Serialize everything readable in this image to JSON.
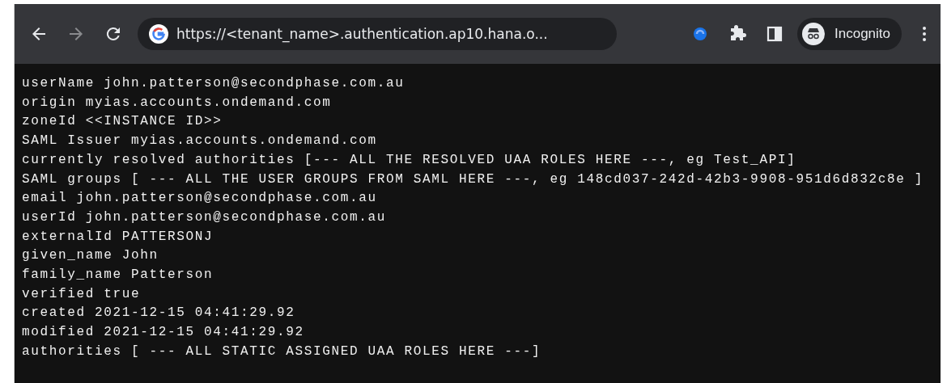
{
  "toolbar": {
    "url": "https://<tenant_name>.authentication.ap10.hana.o...",
    "profile_label": "Incognito"
  },
  "lines": [
    "userName john.patterson@secondphase.com.au",
    "origin myias.accounts.ondemand.com",
    "zoneId <<INSTANCE ID>>",
    "SAML Issuer myias.accounts.ondemand.com",
    "currently resolved authorities [--- ALL THE RESOLVED UAA ROLES HERE ---, eg Test_API]",
    "SAML groups [ --- ALL THE USER GROUPS FROM SAML HERE ---, eg 148cd037-242d-42b3-9908-951d6d832c8e ]",
    "email john.patterson@secondphase.com.au",
    "userId john.patterson@secondphase.com.au",
    "externalId PATTERSONJ",
    "given_name John",
    "family_name Patterson",
    "verified true",
    "created 2021-12-15 04:41:29.92",
    "modified 2021-12-15 04:41:29.92",
    "authorities [ --- ALL STATIC ASSIGNED UAA ROLES HERE ---]"
  ]
}
